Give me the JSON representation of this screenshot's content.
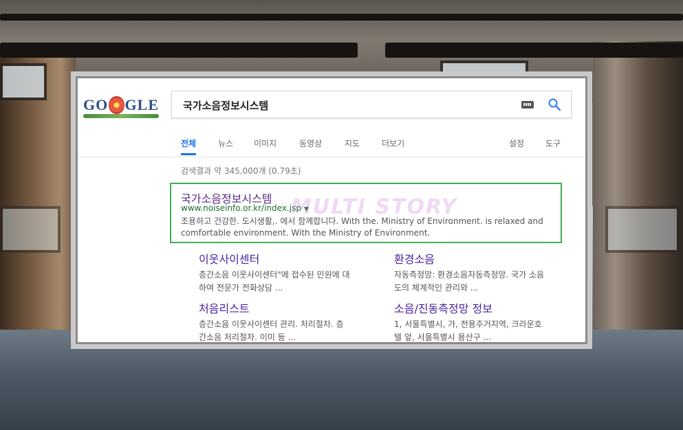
{
  "search": {
    "query": "국가소음정보시스템"
  },
  "logo": {
    "text_left": "GO",
    "text_right": "GLE"
  },
  "tabs": [
    {
      "label": "전체"
    },
    {
      "label": "뉴스"
    },
    {
      "label": "이미지"
    },
    {
      "label": "동영상"
    },
    {
      "label": "지도"
    },
    {
      "label": "더보기"
    }
  ],
  "tools": {
    "settings": "설정",
    "tools": "도구"
  },
  "stats": "검색결과 약 345,000개 (0.79초)",
  "result": {
    "title": "국가소음정보시스템",
    "url": "www.noiseinfo.or.kr/index.jsp",
    "snippet": "조용하고 건강한. 도시생활,. 에서 함께합니다. With the. Ministry of Environment. is relaxed and comfortable environment. With the Ministry of Environment."
  },
  "watermark": "MULTI STORY",
  "sitelinks": [
    {
      "title": "이웃사이센터",
      "desc": "층간소음 이웃사이센터\"에 접수된 민원에 대하여 전문가 전화상담 ..."
    },
    {
      "title": "환경소음",
      "desc": "자동측정망: 환경소음자동측정망. 국가 소음도의 체계적인 관리와 ..."
    },
    {
      "title": "처음리스트",
      "desc": "층간소음 이웃사이센터 관리. 처리절차. 층간소음 처리절차. 이미 등 ..."
    },
    {
      "title": "소음/진동측정망 정보",
      "desc": "1, 서울특별시, 가, 전용주거지역, 크라운호텔 앞, 서울특별시 용산구 ..."
    }
  ],
  "colors": {
    "highlight_border": "#3fae4b",
    "arrow": "#6d9a86",
    "active_tab": "#1a73e8"
  }
}
